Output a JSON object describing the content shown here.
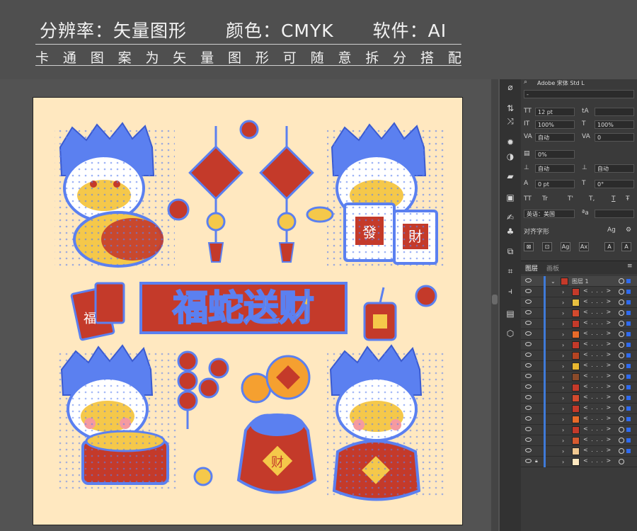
{
  "banner": {
    "title_resolution": "分辨率：矢量图形",
    "title_color": "颜色：CMYK",
    "title_software": "软件：AI",
    "subtitle_chars": [
      "卡",
      "通",
      "图",
      "案",
      "为",
      "矢",
      "量",
      "图",
      "形",
      "可",
      "随",
      "意",
      "拆",
      "分",
      "搭",
      "配"
    ]
  },
  "artwork": {
    "banner_text": "福蛇送财",
    "envelope_char": "福",
    "bag_char": "财",
    "card_chars": [
      "發",
      "財"
    ]
  },
  "char_panel": {
    "font_name": "Adobe 宋体 Std L",
    "font_style": "-",
    "font_size": "12 pt",
    "leading": "",
    "vscale": "100%",
    "hscale": "100%",
    "kerning": "自动",
    "tracking": "0",
    "tsume": "0%",
    "aki_left": "自动",
    "aki_right": "自动",
    "baseline": "0 pt",
    "rotation": "0°",
    "tt_buttons": [
      "TT",
      "Tr",
      "T'",
      "T,",
      "T",
      "Ŧ"
    ],
    "language": "英语：美国",
    "aa_label": "ªa",
    "align_glyphs": "对齐字形",
    "glyph_buttons": [
      "⊠",
      "⊡",
      "Ag",
      "Ax",
      "A",
      "A"
    ]
  },
  "layers": {
    "tabs": [
      "图层",
      "画板"
    ],
    "top_layer_name": "图层 1",
    "sublayer_count": 17,
    "sublayer_label": "< . . . >",
    "thumb_colors": [
      "#c43a2a",
      "#e8c040",
      "#d24a2e",
      "#c43a2a",
      "#e86b2a",
      "#c43a2a",
      "#b54422",
      "#e8b830",
      "#8a4a2a",
      "#c43a2a",
      "#d24a2e",
      "#c43a2a",
      "#e86b2a",
      "#c43a2a",
      "#d65a30",
      "#f0c890",
      "#ffe8c0"
    ]
  },
  "colors": {
    "accent_blue": "#5b80f0",
    "red": "#c43a2a",
    "yellow": "#f5c84a",
    "artboard_bg": "#ffe8c0"
  }
}
